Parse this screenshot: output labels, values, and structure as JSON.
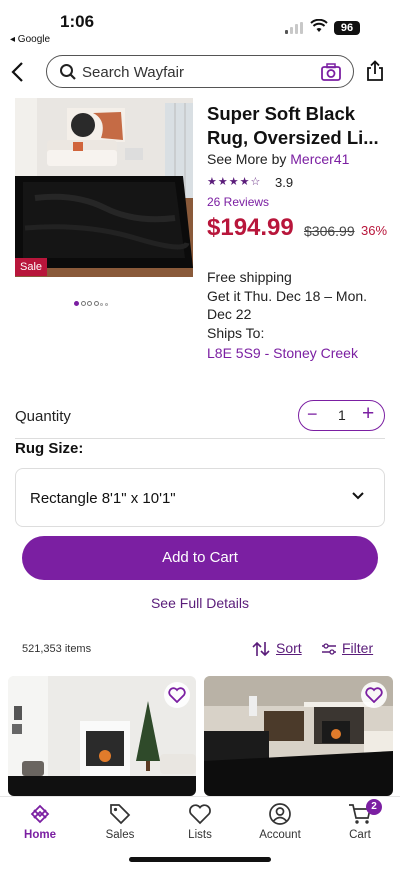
{
  "status_bar": {
    "time": "1:06",
    "back_app": "◂ Google",
    "battery": "96"
  },
  "search": {
    "placeholder": "Search Wayfair"
  },
  "product": {
    "title": "Super Soft Black Rug, Oversized Li...",
    "see_more_prefix": "See More by ",
    "brand": "Mercer41",
    "stars": "★★★★☆",
    "rating": "3.9",
    "reviews": "26 Reviews",
    "price": "$194.99",
    "old_price": "$306.99",
    "discount": "36%",
    "sale_badge": "Sale",
    "image_count": 6,
    "active_image": 1
  },
  "shipping": {
    "line1": "Free shipping",
    "line2": "Get it Thu. Dec 18 – Mon. Dec 22",
    "line3": "Ships To:",
    "location": "L8E 5S9 - Stoney Creek"
  },
  "quantity": {
    "label": "Quantity",
    "value": "1",
    "minus": "−",
    "plus": "+"
  },
  "rug_size": {
    "label": "Rug Size:",
    "selected": "Rectangle 8'1\" x 10'1\""
  },
  "actions": {
    "add_to_cart": "Add to Cart",
    "see_details": "See Full Details"
  },
  "results": {
    "count": "521,353 items",
    "sort": "Sort",
    "filter": "Filter"
  },
  "tabs": [
    {
      "label": "Home",
      "icon": "home-icon",
      "active": true
    },
    {
      "label": "Sales",
      "icon": "tag-icon"
    },
    {
      "label": "Lists",
      "icon": "heart-icon"
    },
    {
      "label": "Account",
      "icon": "account-icon"
    },
    {
      "label": "Cart",
      "icon": "cart-icon",
      "badge": "2"
    }
  ],
  "colors": {
    "brand_purple": "#7b1fa2",
    "sale_red": "#b8163b"
  }
}
